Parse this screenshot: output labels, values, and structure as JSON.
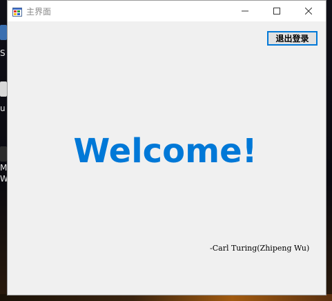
{
  "window": {
    "title": "主界面",
    "app_icon": "winforms-app-icon",
    "controls": {
      "minimize_icon": "minimize-icon",
      "maximize_icon": "maximize-icon",
      "close_icon": "close-icon"
    }
  },
  "main": {
    "logout_label": "退出登录",
    "welcome_text": "Welcome!",
    "signature_text": "-Carl Turing(Zhipeng Wu)"
  },
  "colors": {
    "accent": "#0078d7",
    "client_bg": "#f0f0f0",
    "titlebar_bg": "#ffffff"
  }
}
